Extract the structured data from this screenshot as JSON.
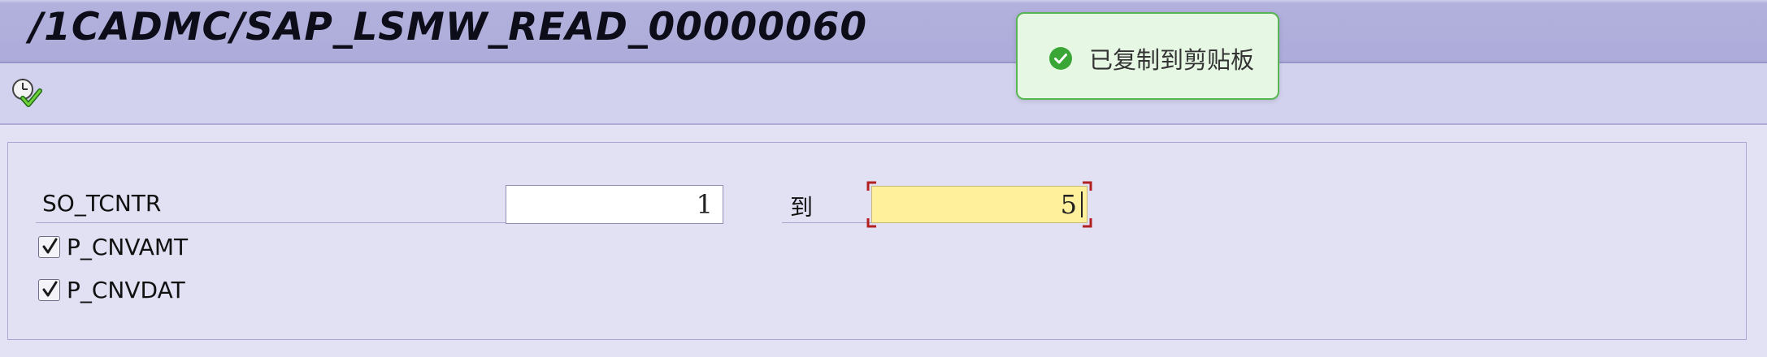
{
  "window": {
    "title": "/1CADMC/SAP_LSMW_READ_00000060"
  },
  "toolbar": {
    "execute_icon": "execute-clock-check-icon"
  },
  "selection": {
    "range": {
      "label": "SO_TCNTR",
      "low_value": "1",
      "to_label": "到",
      "high_value": "5"
    },
    "checkboxes": [
      {
        "label": "P_CNVAMT",
        "checked": true
      },
      {
        "label": "P_CNVDAT",
        "checked": true
      }
    ]
  },
  "toast": {
    "message": "已复制到剪贴板",
    "icon": "success-check-icon"
  },
  "colors": {
    "title_bar": "#adabd9",
    "toolbar": "#d3d2ee",
    "background": "#e3e2f4",
    "focused_field": "#fff09c",
    "toast_border": "#58b553",
    "toast_icon": "#3aa635"
  }
}
